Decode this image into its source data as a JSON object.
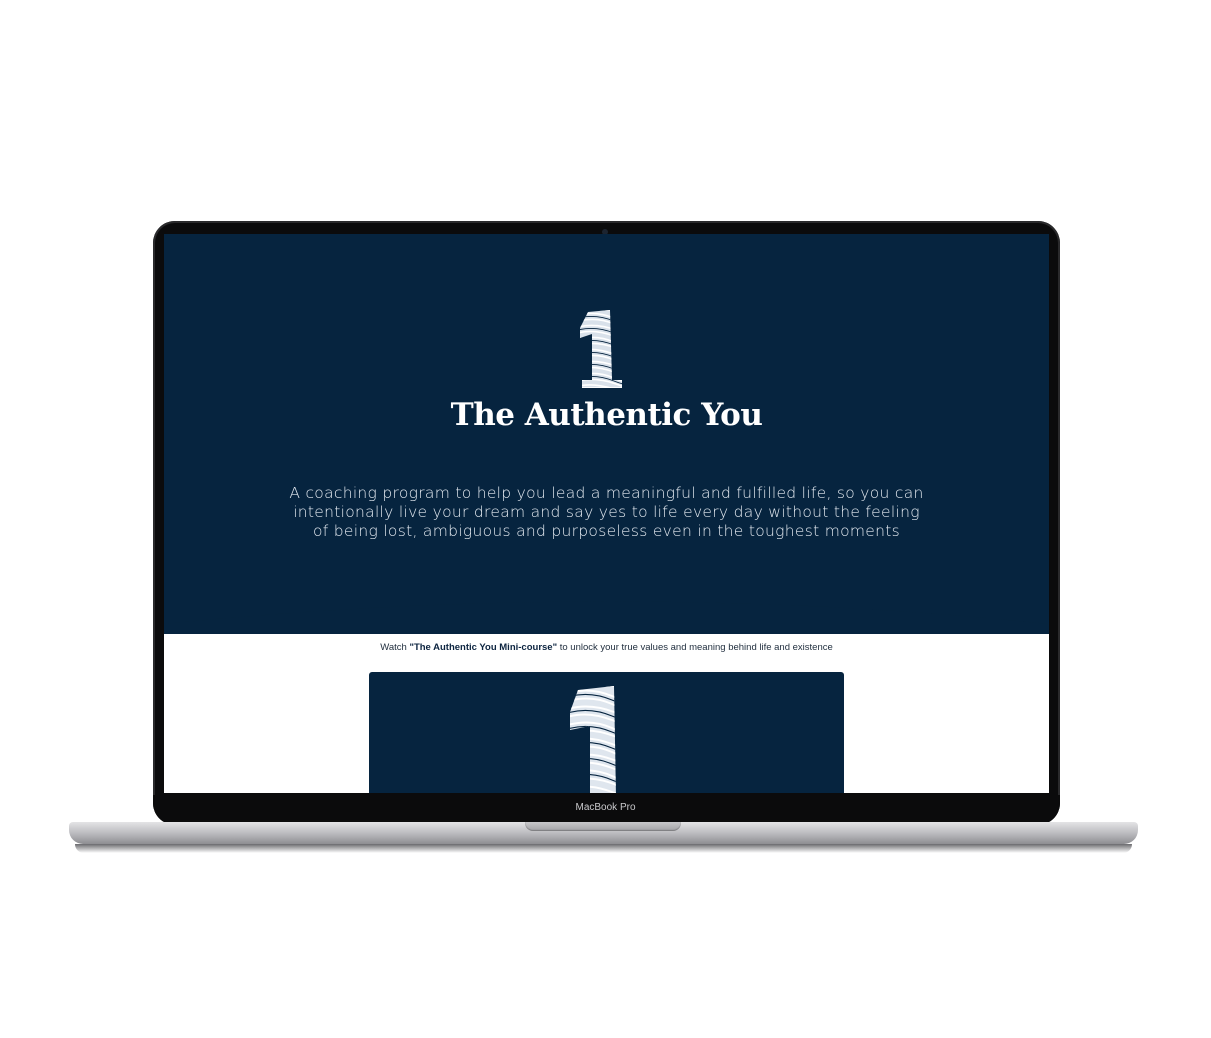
{
  "hero": {
    "title": "The Authentic You",
    "description": "A coaching program to help you lead a meaningful and fulfilled life, so you can intentionally live your dream and say yes to life every day without the feeling of being lost, ambiguous and purposeless even in the toughest moments",
    "logo_icon": "fingerprint-number-one-icon"
  },
  "section": {
    "watch_prefix": "Watch ",
    "watch_course": "\"The Authentic You Mini-course\"",
    "watch_suffix": " to unlock your true values and meaning behind life and existence"
  },
  "video": {
    "thumbnail_icon": "fingerprint-number-one-icon"
  },
  "device": {
    "label": "MacBook Pro"
  },
  "colors": {
    "navy": "#06243f",
    "white": "#ffffff"
  }
}
